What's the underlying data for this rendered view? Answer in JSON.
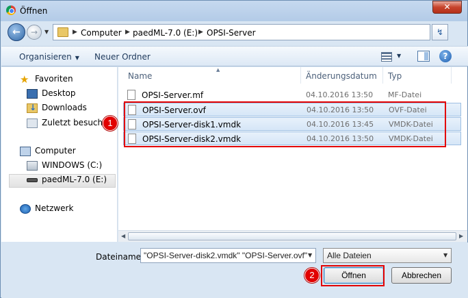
{
  "window": {
    "title": "Öffnen",
    "close_glyph": "✕"
  },
  "address_bar": {
    "crumbs": [
      "Computer",
      "paedML-7.0 (E:)",
      "OPSI-Server"
    ],
    "back_glyph": "←",
    "forward_glyph": "→",
    "refresh_glyph": "↯"
  },
  "toolbar": {
    "organize_label": "Organisieren",
    "new_folder_label": "Neuer Ordner",
    "help_glyph": "?"
  },
  "nav_pane": {
    "favorites_label": "Favoriten",
    "desktop_label": "Desktop",
    "downloads_label": "Downloads",
    "recent_label": "Zuletzt besucht",
    "computer_label": "Computer",
    "drive_c_label": "WINDOWS (C:)",
    "drive_e_label": "paedML-7.0 (E:)",
    "network_label": "Netzwerk"
  },
  "file_list": {
    "headers": {
      "name": "Name",
      "date": "Änderungsdatum",
      "type": "Typ"
    },
    "rows": [
      {
        "name": "OPSI-Server.mf",
        "date": "04.10.2016 13:50",
        "type": "MF-Datei",
        "selected": false
      },
      {
        "name": "OPSI-Server.ovf",
        "date": "04.10.2016 13:50",
        "type": "OVF-Datei",
        "selected": true
      },
      {
        "name": "OPSI-Server-disk1.vmdk",
        "date": "04.10.2016 13:45",
        "type": "VMDK-Datei",
        "selected": true
      },
      {
        "name": "OPSI-Server-disk2.vmdk",
        "date": "04.10.2016 13:50",
        "type": "VMDK-Datei",
        "selected": true
      }
    ]
  },
  "bottom": {
    "filename_label": "Dateiname:",
    "filename_value": "\"OPSI-Server-disk2.vmdk\" \"OPSI-Server.ovf\"",
    "filter_value": "Alle Dateien",
    "open_label": "Öffnen",
    "cancel_label": "Abbrechen"
  },
  "annotations": {
    "badge1": "1",
    "badge2": "2",
    "color": "#e30000"
  }
}
